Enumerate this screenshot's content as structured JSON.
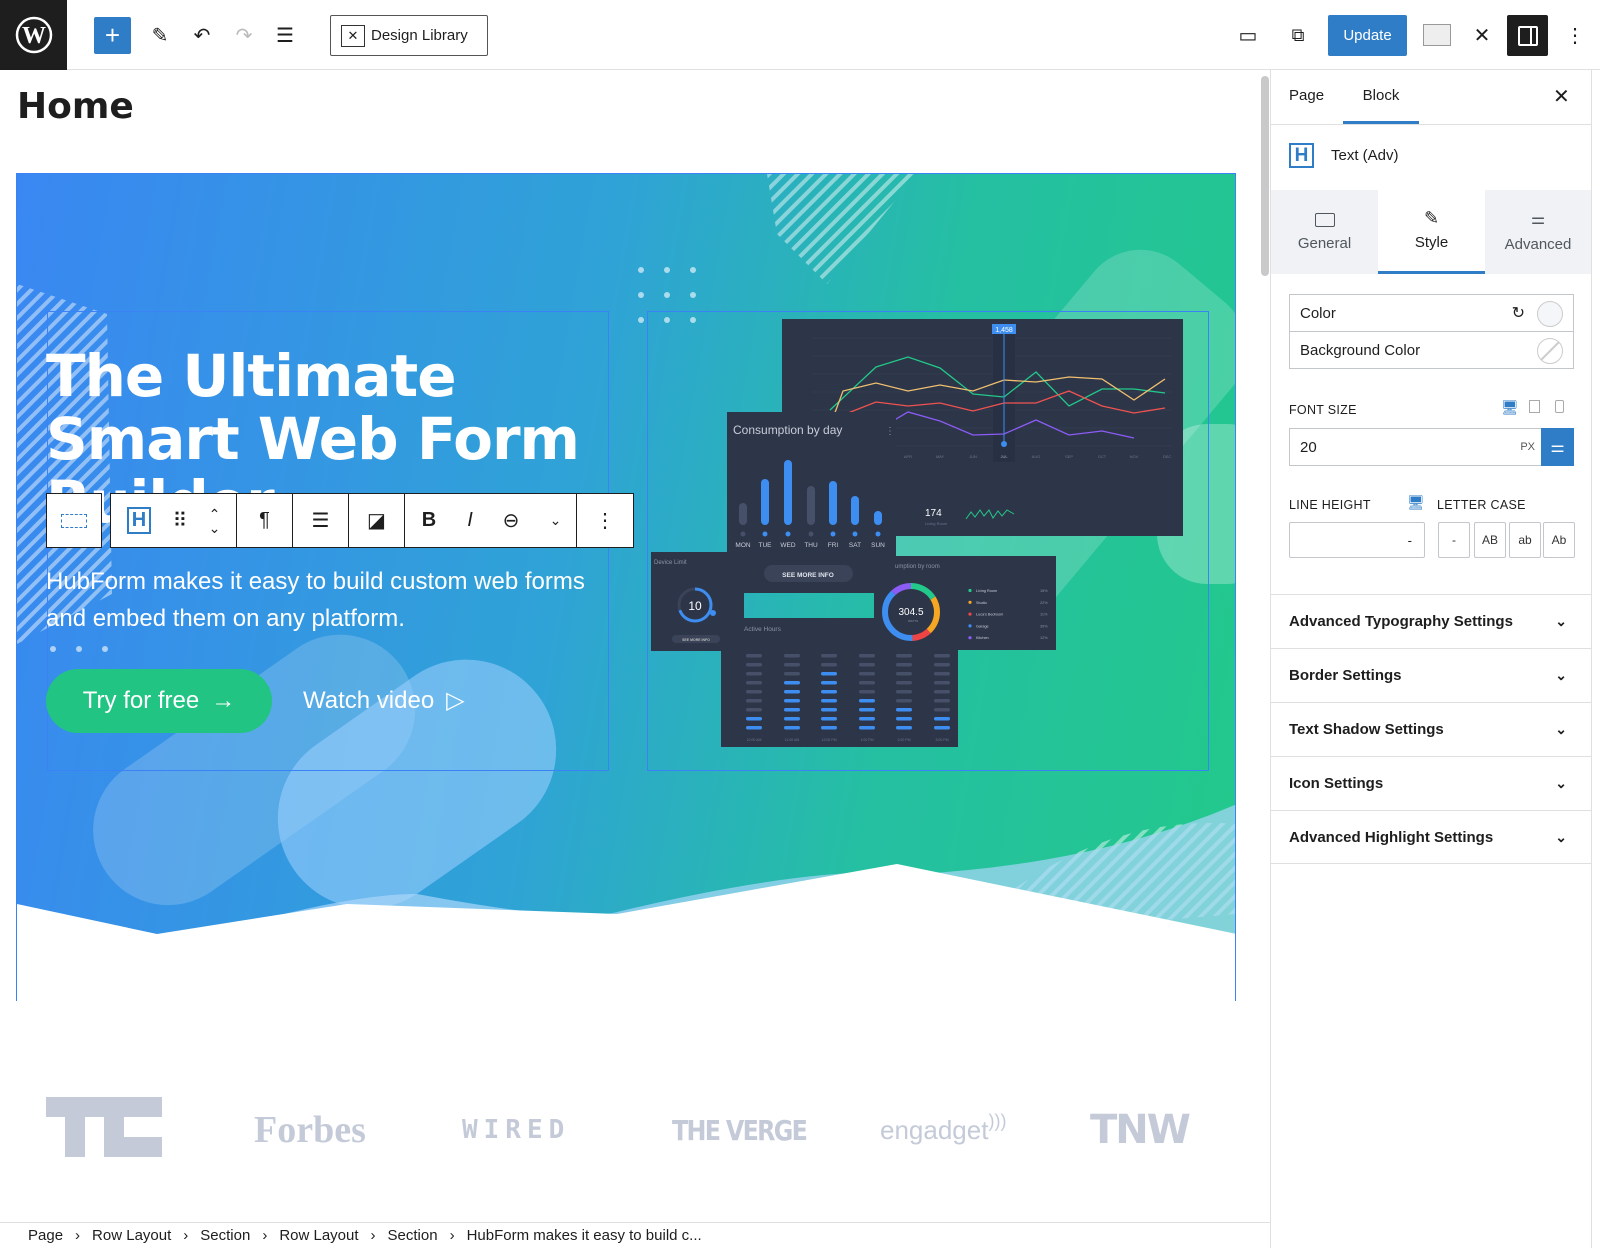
{
  "topbar": {
    "add_label": "+",
    "design_library_label": "Design Library",
    "update_label": "Update"
  },
  "page": {
    "title": "Home"
  },
  "hero": {
    "heading_line1": "The Ultimate",
    "heading_line2": "Smart Web Form",
    "heading_line3": "Builder",
    "paragraph": "HubForm makes it easy to build custom web forms and embed them on any platform.",
    "try_label": "Try for free",
    "watch_label": "Watch video",
    "dashboard": {
      "line_tooltip": "1,458",
      "months": [
        "APR",
        "MAY",
        "JUN",
        "JUL",
        "AUG",
        "SEP",
        "OCT",
        "NOV",
        "DEC"
      ],
      "stat_value": "174",
      "stat_label": "Living Room",
      "consumption_title": "Consumption by day",
      "days": [
        "MON",
        "TUE",
        "WED",
        "THU",
        "FRI",
        "SAT",
        "SUN"
      ],
      "see_more": "SEE MORE INFO",
      "device_title": "Device Limit",
      "device_value": "10",
      "device_see_more": "SEE MORE INFO",
      "active_title": "Active Hours",
      "active_times": [
        "10:00 AM",
        "11:00 AM",
        "12:00 PM",
        "1:00 PM",
        "2:00 PM",
        "3:00 PM"
      ],
      "room_title": "umption by room",
      "room_value": "304.5",
      "room_unit": "WATTS",
      "rooms": [
        {
          "name": "Living Room",
          "pct": "16%",
          "color": "#22c98a"
        },
        {
          "name": "Studio",
          "pct": "22%",
          "color": "#f5a623"
        },
        {
          "name": "Luca's Bedroom",
          "pct": "11%",
          "color": "#ef4444"
        },
        {
          "name": "Garage",
          "pct": "39%",
          "color": "#3d8ef0"
        },
        {
          "name": "Kitchen",
          "pct": "12%",
          "color": "#8b5cf6"
        }
      ]
    }
  },
  "logos": [
    "TC",
    "Forbes",
    "WIRED",
    "THE VERGE",
    "engadget",
    "TNW"
  ],
  "breadcrumbs": [
    "Page",
    "Row Layout",
    "Section",
    "Row Layout",
    "Section",
    "HubForm makes it easy to build c..."
  ],
  "sidebar": {
    "tabs": [
      "Page",
      "Block"
    ],
    "active_tab": "Block",
    "block_name": "Text (Adv)",
    "block_icon_letter": "H",
    "subtabs": [
      "General",
      "Style",
      "Advanced"
    ],
    "active_subtab": "Style",
    "color_label": "Color",
    "bg_color_label": "Background Color",
    "font_size_label": "FONT SIZE",
    "font_size_value": "20",
    "font_size_unit": "PX",
    "line_height_label": "LINE HEIGHT",
    "line_height_value": "-",
    "letter_case_label": "LETTER CASE",
    "letter_case_options": [
      "-",
      "AB",
      "ab",
      "Ab"
    ],
    "accordions": [
      "Advanced Typography Settings",
      "Border Settings",
      "Text Shadow Settings",
      "Icon Settings",
      "Advanced Highlight Settings"
    ]
  },
  "colors": {
    "accent": "#2f7dc6",
    "cta_green": "#22c483",
    "hero_start": "#3a87f2",
    "hero_end": "#22c98a"
  }
}
